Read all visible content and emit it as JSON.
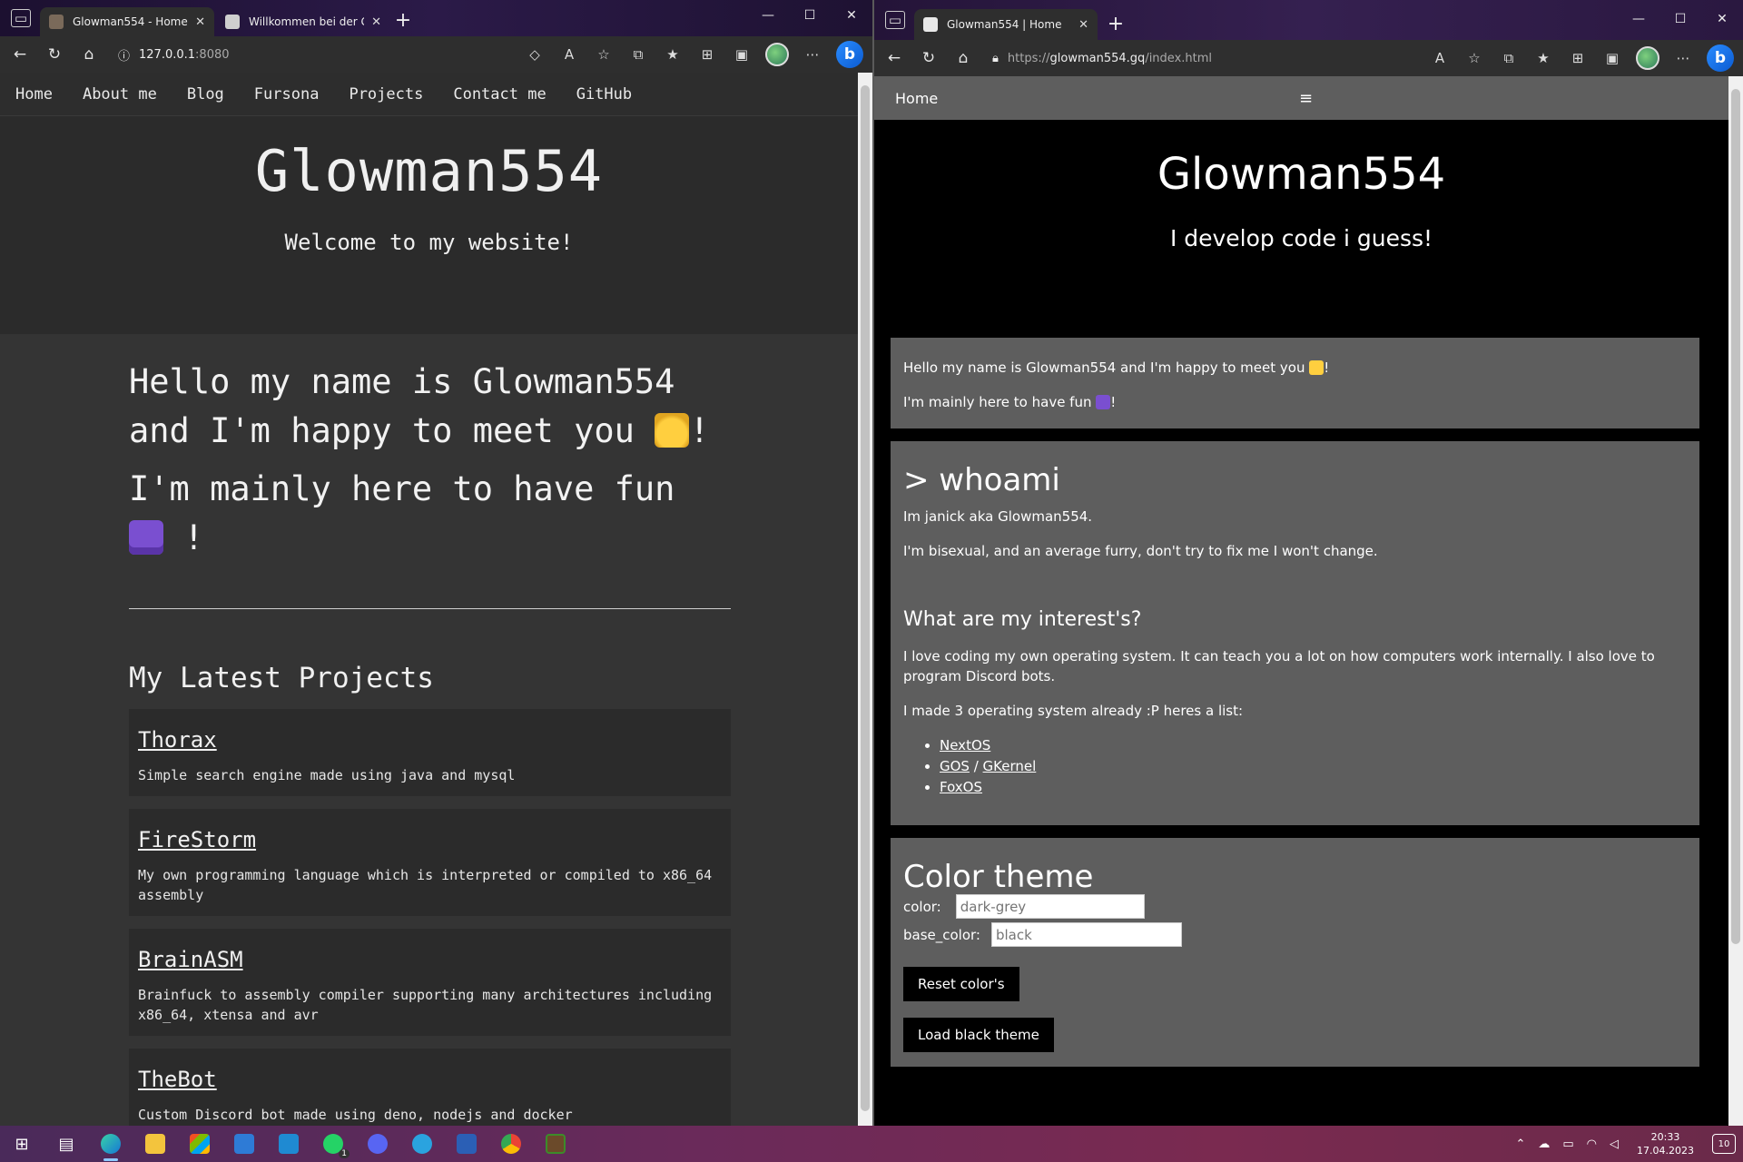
{
  "left_browser": {
    "tabs": [
      {
        "title": "Glowman554 - Home",
        "active": true
      },
      {
        "title": "Willkommen bei der Google Sea",
        "active": false
      }
    ],
    "url_host": "127.0.0.1",
    "url_port": ":8080",
    "page": {
      "nav": [
        "Home",
        "About me",
        "Blog",
        "Fursona",
        "Projects",
        "Contact me",
        "GitHub"
      ],
      "title": "Glowman554",
      "subtitle": "Welcome to my website!",
      "hello_line1": "Hello my name is Glowman554 and I'm happy to meet you",
      "hello_line1_end": "!",
      "hello_line2": "I'm mainly here to have fun",
      "hello_line2_end": "!",
      "projects_heading": "My Latest Projects",
      "projects": [
        {
          "name": "Thorax",
          "desc": "Simple search engine made using java and mysql"
        },
        {
          "name": "FireStorm",
          "desc": "My own programming language which is interpreted or compiled to x86_64 assembly"
        },
        {
          "name": "BrainASM",
          "desc": "Brainfuck to assembly compiler supporting many architectures including x86_64, xtensa and avr"
        },
        {
          "name": "TheBot",
          "desc": "Custom Discord bot made using deno, nodejs and docker"
        }
      ]
    }
  },
  "right_browser": {
    "tabs": [
      {
        "title": "Glowman554 | Home",
        "active": true
      }
    ],
    "url_prefix": "https://",
    "url_host": "glowman554.gq",
    "url_path": "/index.html",
    "page": {
      "nav_home": "Home",
      "menu_glyph": "≡",
      "title": "Glowman554",
      "subtitle": "I develop code i guess!",
      "intro_1": "Hello my name is Glowman554 and I'm happy to meet you",
      "intro_1_end": "!",
      "intro_2": "I'm mainly here to have fun",
      "intro_2_end": "!",
      "whoami_heading": "> whoami",
      "whoami_1": "Im janick aka Glowman554.",
      "whoami_2": "I'm bisexual, and an average furry, don't try to fix me I won't change.",
      "interests_heading": "What are my interest's?",
      "interests_1": "I love coding my own operating system. It can teach you a lot on how computers work internally. I also love to program Discord bots.",
      "interests_2": "I made 3 operating system already :P heres a list:",
      "os_list": {
        "nextos": "NextOS",
        "gos": "GOS",
        "sep": " / ",
        "gkernel": "GKernel",
        "foxos": "FoxOS"
      },
      "theme_heading": "Color theme",
      "color_label": "color:",
      "color_placeholder": "dark-grey",
      "base_color_label": "base_color:",
      "base_color_placeholder": "black",
      "reset_button": "Reset color's",
      "load_black_button": "Load black theme"
    }
  },
  "taskbar": {
    "time": "20:33",
    "date": "17.04.2023",
    "notifications": "10",
    "whatsapp_badge": "1"
  },
  "colors": {
    "left_page_bg": "#343434",
    "left_header_bg": "#2b2b2b",
    "right_page_bg": "#000000",
    "right_section_bg": "#5e5e5e",
    "bing_blue": "#2a8cff"
  }
}
